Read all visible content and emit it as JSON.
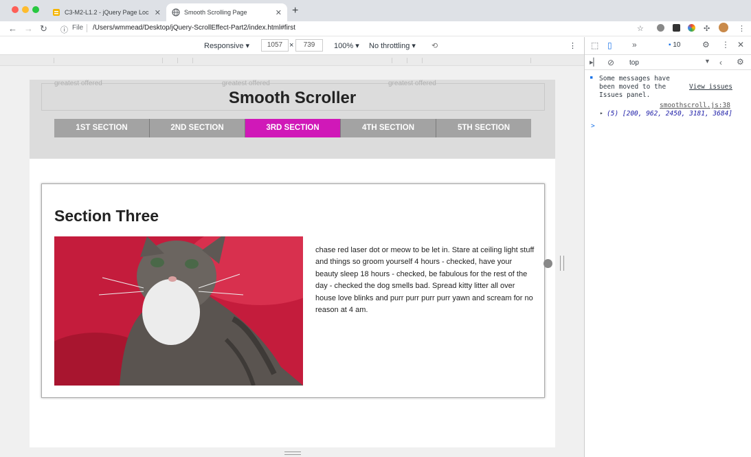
{
  "browser": {
    "tabs": [
      {
        "title": "C3-M2-L1.2 - jQuery Page Loc",
        "active": false
      },
      {
        "title": "Smooth Scrolling Page",
        "active": true
      }
    ],
    "address": {
      "scheme_label": "File",
      "url": "/Users/wmmead/Desktop/jQuery-ScrollEffect-Part2/index.html#first"
    }
  },
  "device_toolbar": {
    "mode": "Responsive",
    "width": "1057",
    "height": "739",
    "zoom": "100%",
    "throttling": "No throttling"
  },
  "page": {
    "site_title": "Smooth Scroller",
    "nav": [
      {
        "label": "1ST SECTION",
        "active": false
      },
      {
        "label": "2ND SECTION",
        "active": false
      },
      {
        "label": "3RD SECTION",
        "active": true
      },
      {
        "label": "4TH SECTION",
        "active": false
      },
      {
        "label": "5TH SECTION",
        "active": false
      }
    ],
    "ghost_texts": [
      "greatest offered",
      "greatest offered",
      "greatest offered"
    ],
    "section": {
      "heading": "Section Three",
      "body": "chase red laser dot or meow to be let in. Stare at ceiling light stuff and things so groom yourself 4 hours - checked, have your beauty sleep 18 hours - checked, be fabulous for the rest of the day - checked the dog smells bad. Spread kitty litter all over house love blinks and purr purr purr purr yawn and scream for no reason at 4 am."
    }
  },
  "devtools": {
    "issue_count": "10",
    "context": "top",
    "message": "Some messages have been moved to the Issues panel.",
    "view_issues": "View issues",
    "source": "smoothscroll.js:38",
    "array_output": "(5) [200, 962, 2450, 3181, 3684]",
    "prompt": ">"
  },
  "colors": {
    "active_nav": "#d018b8",
    "nav": "#a3a3a3",
    "kitten_bg": "#c41c3c"
  }
}
